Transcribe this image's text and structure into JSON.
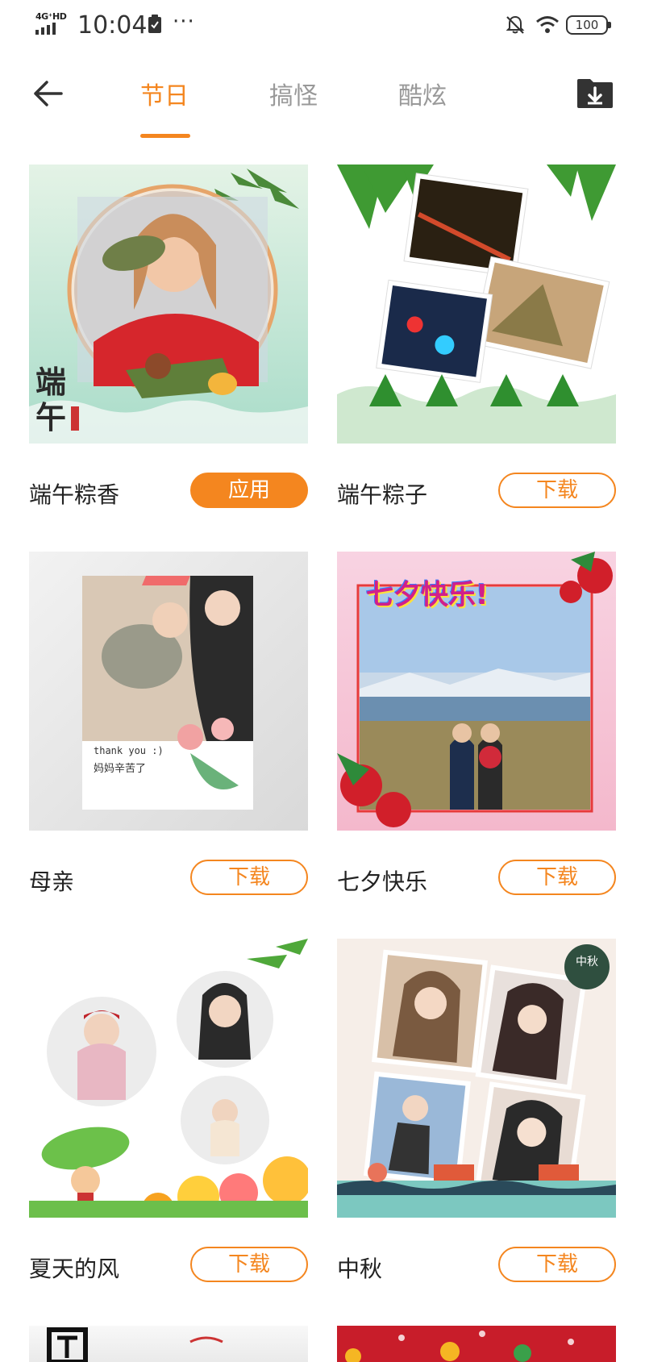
{
  "status_bar": {
    "network": "4G⁺HD",
    "time": "10:04",
    "more": "···",
    "battery": "100"
  },
  "header": {
    "back_icon": "arrow-left-icon",
    "tabs": [
      {
        "label": "节日",
        "active": true
      },
      {
        "label": "搞怪",
        "active": false
      },
      {
        "label": "酷炫",
        "active": false
      }
    ],
    "download_icon": "folder-download-icon"
  },
  "accent_color": "#f4861f",
  "templates": [
    {
      "name": "端午粽香",
      "button": "应用",
      "button_style": "filled"
    },
    {
      "name": "端午粽子",
      "button": "下载",
      "button_style": "outline"
    },
    {
      "name": "母亲",
      "button": "下载",
      "button_style": "outline"
    },
    {
      "name": "七夕快乐",
      "button": "下载",
      "button_style": "outline"
    },
    {
      "name": "夏天的风",
      "button": "下载",
      "button_style": "outline"
    },
    {
      "name": "中秋",
      "button": "下载",
      "button_style": "outline"
    }
  ],
  "thumb_text": {
    "duanwu_calligraphy": "端午",
    "qixi_banner": "七夕快乐!",
    "mother_note_1": "thank you :)",
    "mother_note_2": "妈妈辛苦了",
    "zhongqiu_badge": "中秋"
  }
}
